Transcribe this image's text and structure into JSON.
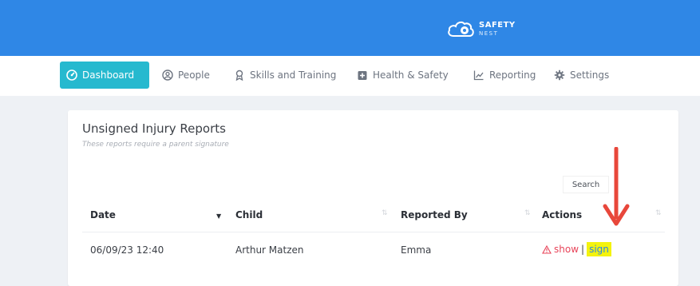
{
  "brand": {
    "logo_top": "SAFETY",
    "logo_bottom": "NEST",
    "colors": {
      "topbar": "#2f87e6",
      "active_tab": "#26b9cf",
      "danger": "#e8455a",
      "highlight": "#f4f30e"
    }
  },
  "nav": {
    "items": [
      {
        "label": "Dashboard",
        "icon": "dashboard-icon",
        "active": true
      },
      {
        "label": "People",
        "icon": "person-icon",
        "active": false
      },
      {
        "label": "Skills and Training",
        "icon": "award-icon",
        "active": false
      },
      {
        "label": "Health & Safety",
        "icon": "medical-icon",
        "active": false
      },
      {
        "label": "Reporting",
        "icon": "chart-icon",
        "active": false
      },
      {
        "label": "Settings",
        "icon": "gear-icon",
        "active": false
      }
    ]
  },
  "card": {
    "title": "Unsigned Injury Reports",
    "subtitle": "These reports require a parent signature",
    "search_label": "Search",
    "columns": [
      "Date",
      "Child",
      "Reported By",
      "Actions"
    ],
    "rows": [
      {
        "date": "06/09/23 12:40",
        "child": "Arthur Matzen",
        "reported_by": "Emma",
        "show": "show",
        "separator": "|",
        "sign": "sign"
      }
    ]
  }
}
